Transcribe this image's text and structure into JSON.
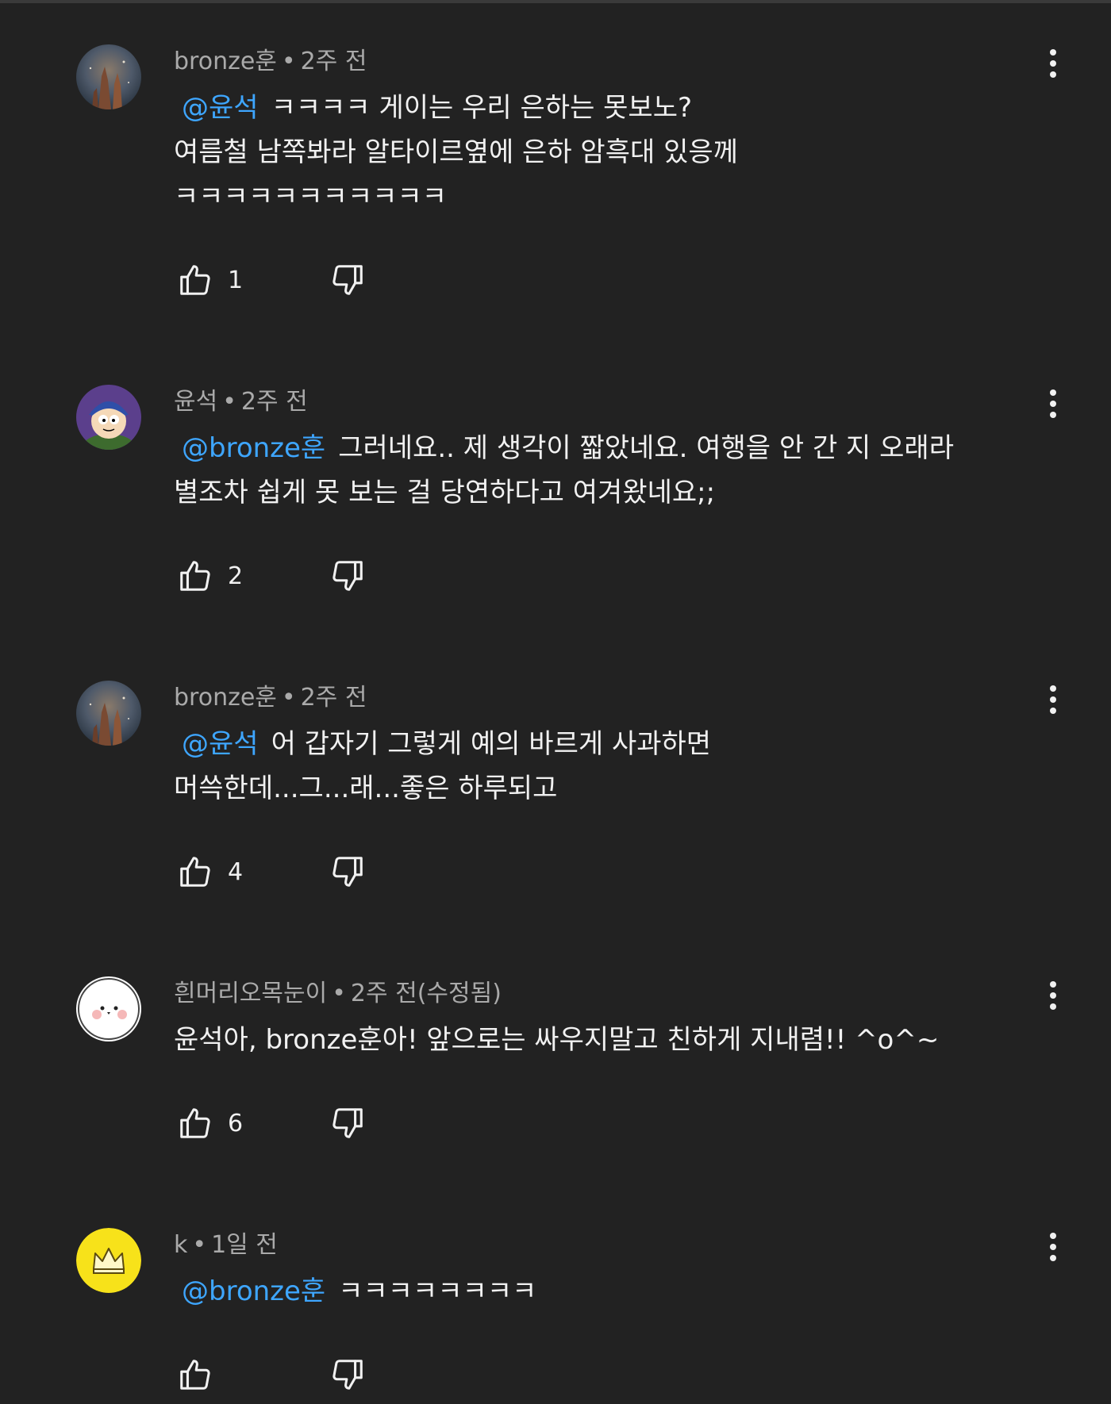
{
  "comments": [
    {
      "author": "bronze훈",
      "time": "2주 전",
      "mention": "@윤석",
      "lines": [
        "ㅋㅋㅋㅋ 게이는 우리 은하는 못보노?",
        "여름철 남쪽봐라 알타이르옆에 은하 암흑대 있응께",
        "ㅋㅋㅋㅋㅋㅋㅋㅋㅋㅋㅋ"
      ],
      "likes": "1",
      "avatar": "nebula-avatar"
    },
    {
      "author": "윤석",
      "time": "2주 전",
      "mention": "@bronze훈",
      "lines": [
        "그러네요.. 제 생각이 짧았네요. 여행을 안 간 지 오래라",
        "별조차 쉽게 못 보는 걸 당연하다고 여겨왔네요;;"
      ],
      "likes": "2",
      "avatar": "cartoon-avatar"
    },
    {
      "author": "bronze훈",
      "time": "2주 전",
      "mention": "@윤석",
      "lines": [
        "어 갑자기 그렇게 예의 바르게 사과하면",
        "머쓱한데...그...래...좋은 하루되고"
      ],
      "likes": "4",
      "avatar": "nebula-avatar"
    },
    {
      "author": "흰머리오목눈이",
      "time": "2주 전(수정됨)",
      "mention": "",
      "lines": [
        "윤석아, bronze훈아! 앞으로는 싸우지말고 친하게 지내렴!! ^o^~"
      ],
      "likes": "6",
      "avatar": "white-bird-avatar"
    },
    {
      "author": "k",
      "time": "1일 전",
      "mention": "@bronze훈",
      "lines": [
        "ㅋㅋㅋㅋㅋㅋㅋㅋ"
      ],
      "likes": "",
      "avatar": "crown-avatar"
    }
  ],
  "separator": "•",
  "icons": {
    "like": "thumbs-up-icon",
    "dislike": "thumbs-down-icon",
    "more": "more-vert-icon"
  },
  "colors": {
    "background": "#222222",
    "text": "#f1f1f1",
    "meta": "#aaaaaa",
    "mention": "#3ea6ff"
  }
}
